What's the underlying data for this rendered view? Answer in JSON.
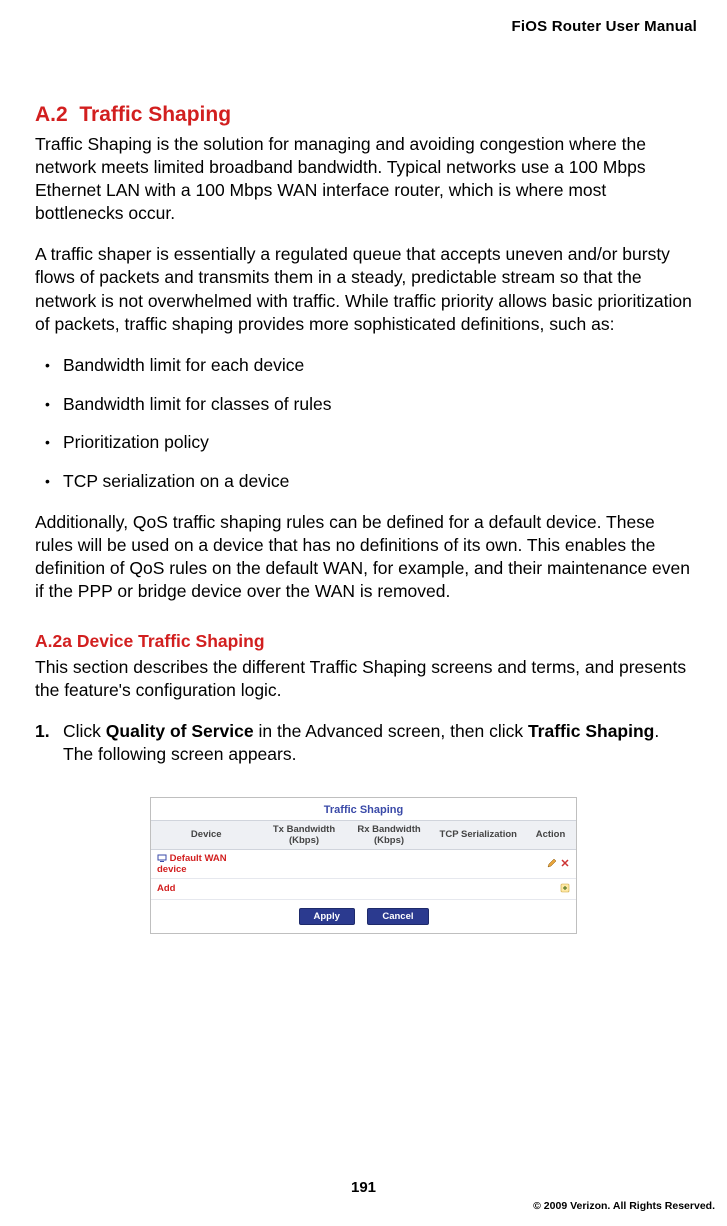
{
  "header": {
    "running_head": "FiOS Router User Manual"
  },
  "section": {
    "number": "A.2",
    "title": "Traffic Shaping",
    "para1": "Traffic Shaping is the solution for managing and avoiding congestion where the network meets limited broadband bandwidth. Typical networks use a 100 Mbps Ethernet LAN with a 100 Mbps WAN interface router, which is where most bottlenecks occur.",
    "para2": "A traffic shaper is essentially a regulated queue that accepts uneven and/or bursty flows of packets and transmits them in a steady, predictable stream so that the network is not overwhelmed with traffic. While traffic priority allows basic prioritization of packets, traffic shaping provides more sophisticated definitions, such as:",
    "bullets": [
      "Bandwidth limit for each device",
      "Bandwidth limit for classes of rules",
      "Prioritization policy",
      "TCP serialization on a device"
    ],
    "para3": "Additionally, QoS traffic shaping rules can be defined for a default device. These rules will be used on a device that has no definitions of its own. This enables the definition of QoS rules on the default WAN, for example, and their maintenance even if the PPP or bridge device over the WAN is removed."
  },
  "subsection": {
    "number": "A.2a",
    "title": "Device Traffic Shaping",
    "intro": "This section describes the different Traffic Shaping screens and terms, and presents the feature's configuration logic.",
    "step1": {
      "num": "1.",
      "pre": "Click ",
      "bold1": "Quality of Service",
      "mid": " in the Advanced screen, then click ",
      "bold2": "Traffic Shaping",
      "post": ". The following screen appears."
    }
  },
  "screenshot": {
    "title": "Traffic Shaping",
    "columns": [
      "Device",
      "Tx Bandwidth (Kbps)",
      "Rx Bandwidth (Kbps)",
      "TCP Serialization",
      "Action"
    ],
    "rows": [
      {
        "device": "Default WAN device",
        "tx": "",
        "rx": "",
        "tcp": "",
        "has_actions": true
      }
    ],
    "add_label": "Add",
    "buttons": {
      "apply": "Apply",
      "cancel": "Cancel"
    }
  },
  "footer": {
    "page_number": "191",
    "copyright": "© 2009 Verizon. All Rights Reserved."
  }
}
